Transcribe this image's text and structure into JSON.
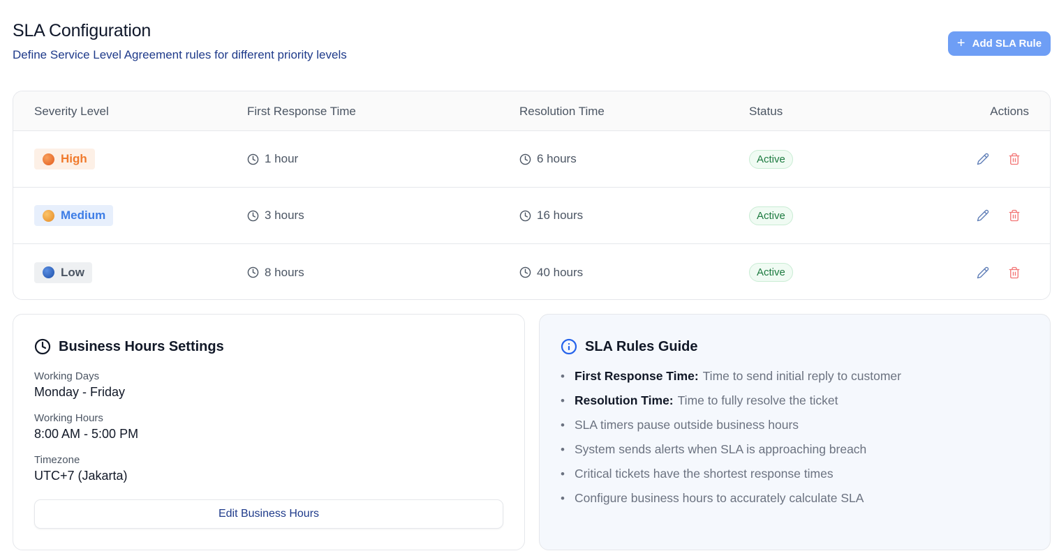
{
  "header": {
    "title": "SLA Configuration",
    "subtitle": "Define Service Level Agreement rules for different priority levels",
    "add_button": "Add SLA Rule"
  },
  "table": {
    "columns": [
      "Severity Level",
      "First Response Time",
      "Resolution Time",
      "Status",
      "Actions"
    ],
    "rows": [
      {
        "severity": "High",
        "first_response": "1 hour",
        "resolution": "6 hours",
        "status": "Active"
      },
      {
        "severity": "Medium",
        "first_response": "3 hours",
        "resolution": "16 hours",
        "status": "Active"
      },
      {
        "severity": "Low",
        "first_response": "8 hours",
        "resolution": "40 hours",
        "status": "Active"
      }
    ]
  },
  "business_hours": {
    "title": "Business Hours Settings",
    "working_days_label": "Working Days",
    "working_days": "Monday - Friday",
    "working_hours_label": "Working Hours",
    "working_hours": "8:00 AM - 5:00 PM",
    "timezone_label": "Timezone",
    "timezone": "UTC+7 (Jakarta)",
    "edit_button": "Edit Business Hours"
  },
  "guide": {
    "title": "SLA Rules Guide",
    "items": [
      {
        "bold": "First Response Time:",
        "text": "Time to send initial reply to customer"
      },
      {
        "bold": "Resolution Time:",
        "text": "Time to fully resolve the ticket"
      },
      {
        "bold": "",
        "text": "SLA timers pause outside business hours"
      },
      {
        "bold": "",
        "text": "System sends alerts when SLA is approaching breach"
      },
      {
        "bold": "",
        "text": "Critical tickets have the shortest response times"
      },
      {
        "bold": "",
        "text": "Configure business hours to accurately calculate SLA"
      }
    ]
  },
  "colors": {
    "accent": "#6e9ef5",
    "high": "#f07a2c",
    "medium": "#3d7de6",
    "active": "#1c7a3f",
    "delete": "#f27474"
  },
  "icons": [
    "plus-icon",
    "clock-icon",
    "edit-icon",
    "trash-icon",
    "info-icon"
  ]
}
